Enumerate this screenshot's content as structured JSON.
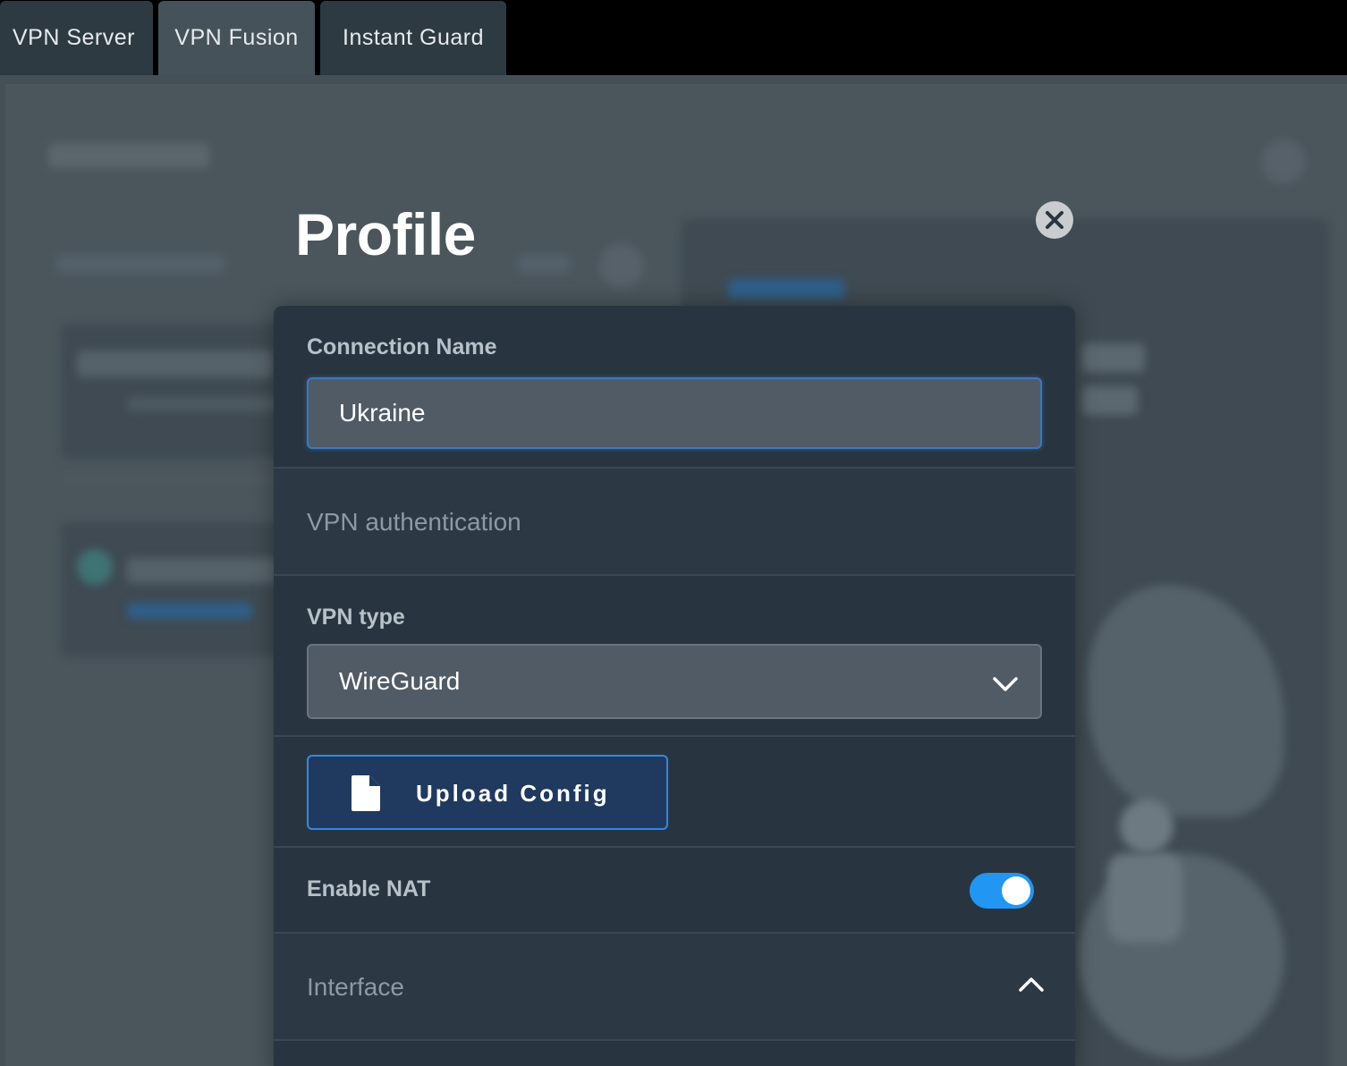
{
  "tabs": [
    {
      "label": "VPN Server"
    },
    {
      "label": "VPN Fusion"
    },
    {
      "label": "Instant Guard"
    }
  ],
  "modal": {
    "title": "Profile",
    "close_icon": "close-icon",
    "connection_name": {
      "label": "Connection Name",
      "value": "Ukraine"
    },
    "vpn_authentication": {
      "label": "VPN authentication"
    },
    "vpn_type": {
      "label": "VPN type",
      "selected": "WireGuard"
    },
    "upload_config": {
      "label": "Upload Config",
      "icon": "file-icon"
    },
    "enable_nat": {
      "label": "Enable NAT",
      "enabled": true
    },
    "interface": {
      "label": "Interface",
      "expanded": true
    }
  },
  "colors": {
    "accent": "#2196f3",
    "panel": "#283540",
    "input": "#505b66"
  }
}
